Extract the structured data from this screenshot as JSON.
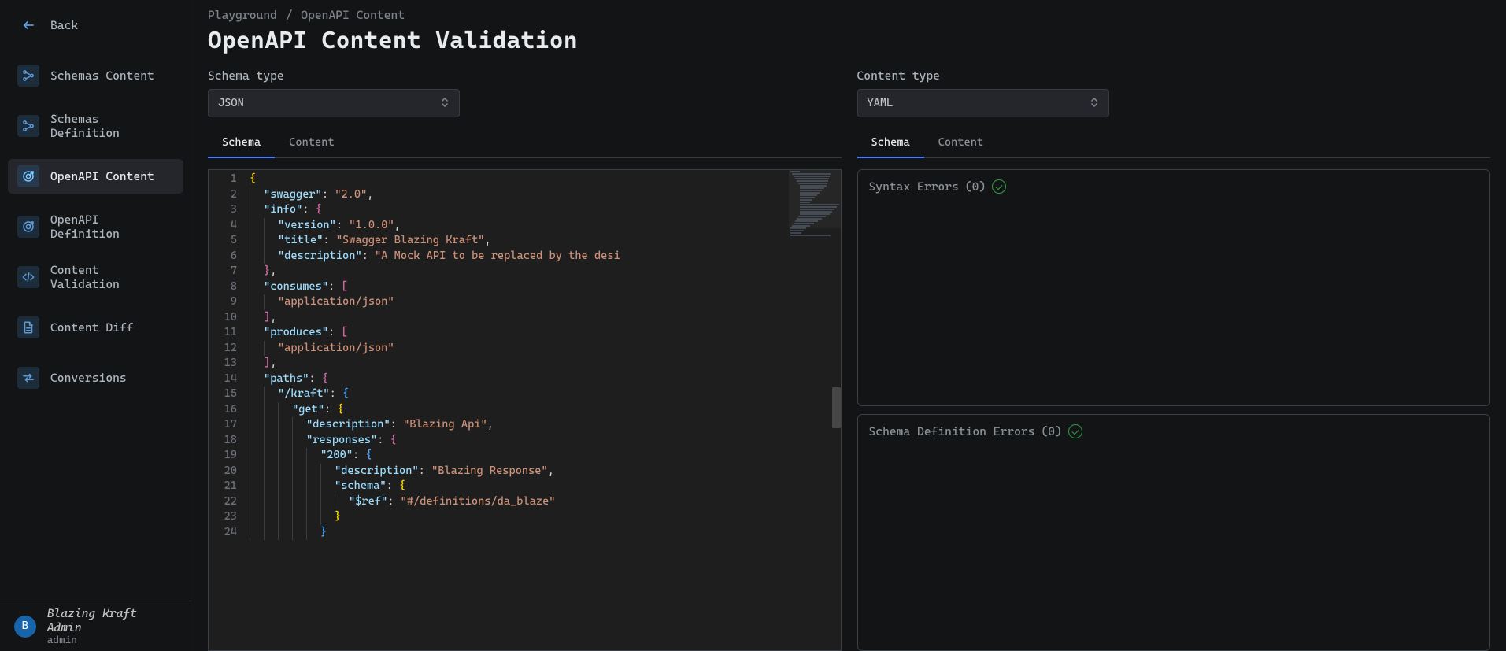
{
  "sidebar": {
    "back_label": "Back",
    "items": [
      {
        "id": "schemas-content",
        "label": "Schemas Content",
        "icon": "graph"
      },
      {
        "id": "schemas-definition",
        "label": "Schemas Definition",
        "icon": "graph"
      },
      {
        "id": "openapi-content",
        "label": "OpenAPI Content",
        "icon": "target",
        "active": true
      },
      {
        "id": "openapi-definition",
        "label": "OpenAPI Definition",
        "icon": "target"
      },
      {
        "id": "content-validation",
        "label": "Content Validation",
        "icon": "code-tag"
      },
      {
        "id": "content-diff",
        "label": "Content Diff",
        "icon": "doc"
      },
      {
        "id": "conversions",
        "label": "Conversions",
        "icon": "swap"
      }
    ],
    "user": {
      "initial": "B",
      "name": "Blazing Kraft Admin",
      "role": "admin"
    }
  },
  "breadcrumb": {
    "root": "Playground",
    "sep": "/",
    "page": "OpenAPI Content"
  },
  "page_title": "OpenAPI Content Validation",
  "left": {
    "select_label": "Schema type",
    "select_value": "JSON",
    "tabs": [
      "Schema",
      "Content"
    ],
    "active_tab": "Schema"
  },
  "right": {
    "select_label": "Content type",
    "select_value": "YAML",
    "tabs": [
      "Schema",
      "Content"
    ],
    "active_tab": "Schema",
    "syntax_errors_label": "Syntax Errors",
    "syntax_errors_count": 0,
    "schema_def_errors_label": "Schema Definition Errors",
    "schema_def_errors_count": 0
  },
  "editor": {
    "line_count": 24,
    "lines": [
      {
        "n": 1,
        "i": 0,
        "t": [
          [
            "brace",
            "{"
          ]
        ]
      },
      {
        "n": 2,
        "i": 1,
        "t": [
          [
            "key",
            "\"swagger\""
          ],
          [
            "punc",
            ": "
          ],
          [
            "str",
            "\"2.0\""
          ],
          [
            "punc",
            ","
          ]
        ]
      },
      {
        "n": 3,
        "i": 1,
        "t": [
          [
            "key",
            "\"info\""
          ],
          [
            "punc",
            ": "
          ],
          [
            "brace2",
            "{"
          ]
        ]
      },
      {
        "n": 4,
        "i": 2,
        "t": [
          [
            "key",
            "\"version\""
          ],
          [
            "punc",
            ": "
          ],
          [
            "str",
            "\"1.0.0\""
          ],
          [
            "punc",
            ","
          ]
        ]
      },
      {
        "n": 5,
        "i": 2,
        "t": [
          [
            "key",
            "\"title\""
          ],
          [
            "punc",
            ": "
          ],
          [
            "str",
            "\"Swagger Blazing Kraft\""
          ],
          [
            "punc",
            ","
          ]
        ]
      },
      {
        "n": 6,
        "i": 2,
        "t": [
          [
            "key",
            "\"description\""
          ],
          [
            "punc",
            ": "
          ],
          [
            "str",
            "\"A Mock API to be replaced by the desi"
          ]
        ]
      },
      {
        "n": 7,
        "i": 1,
        "t": [
          [
            "brace2",
            "}"
          ],
          [
            "punc",
            ","
          ]
        ]
      },
      {
        "n": 8,
        "i": 1,
        "t": [
          [
            "key",
            "\"consumes\""
          ],
          [
            "punc",
            ": "
          ],
          [
            "brace2",
            "["
          ]
        ]
      },
      {
        "n": 9,
        "i": 2,
        "t": [
          [
            "str",
            "\"application/json\""
          ]
        ]
      },
      {
        "n": 10,
        "i": 1,
        "t": [
          [
            "brace2",
            "]"
          ],
          [
            "punc",
            ","
          ]
        ]
      },
      {
        "n": 11,
        "i": 1,
        "t": [
          [
            "key",
            "\"produces\""
          ],
          [
            "punc",
            ": "
          ],
          [
            "brace2",
            "["
          ]
        ]
      },
      {
        "n": 12,
        "i": 2,
        "t": [
          [
            "str",
            "\"application/json\""
          ]
        ]
      },
      {
        "n": 13,
        "i": 1,
        "t": [
          [
            "brace2",
            "]"
          ],
          [
            "punc",
            ","
          ]
        ]
      },
      {
        "n": 14,
        "i": 1,
        "t": [
          [
            "key",
            "\"paths\""
          ],
          [
            "punc",
            ": "
          ],
          [
            "brace2",
            "{"
          ]
        ]
      },
      {
        "n": 15,
        "i": 2,
        "t": [
          [
            "key",
            "\"/kraft\""
          ],
          [
            "punc",
            ": "
          ],
          [
            "brace3",
            "{"
          ]
        ]
      },
      {
        "n": 16,
        "i": 3,
        "t": [
          [
            "key",
            "\"get\""
          ],
          [
            "punc",
            ": "
          ],
          [
            "brace",
            "{"
          ]
        ]
      },
      {
        "n": 17,
        "i": 4,
        "t": [
          [
            "key",
            "\"description\""
          ],
          [
            "punc",
            ": "
          ],
          [
            "str",
            "\"Blazing Api\""
          ],
          [
            "punc",
            ","
          ]
        ]
      },
      {
        "n": 18,
        "i": 4,
        "t": [
          [
            "key",
            "\"responses\""
          ],
          [
            "punc",
            ": "
          ],
          [
            "brace2",
            "{"
          ]
        ]
      },
      {
        "n": 19,
        "i": 5,
        "t": [
          [
            "key",
            "\"200\""
          ],
          [
            "punc",
            ": "
          ],
          [
            "brace3",
            "{"
          ]
        ]
      },
      {
        "n": 20,
        "i": 6,
        "t": [
          [
            "key",
            "\"description\""
          ],
          [
            "punc",
            ": "
          ],
          [
            "str",
            "\"Blazing Response\""
          ],
          [
            "punc",
            ","
          ]
        ]
      },
      {
        "n": 21,
        "i": 6,
        "t": [
          [
            "key",
            "\"schema\""
          ],
          [
            "punc",
            ": "
          ],
          [
            "brace",
            "{"
          ]
        ]
      },
      {
        "n": 22,
        "i": 7,
        "t": [
          [
            "key",
            "\"$ref\""
          ],
          [
            "punc",
            ": "
          ],
          [
            "str",
            "\"#/definitions/da_blaze\""
          ]
        ]
      },
      {
        "n": 23,
        "i": 6,
        "t": [
          [
            "brace",
            "}"
          ]
        ]
      },
      {
        "n": 24,
        "i": 5,
        "t": [
          [
            "brace3",
            "}"
          ]
        ]
      }
    ]
  }
}
